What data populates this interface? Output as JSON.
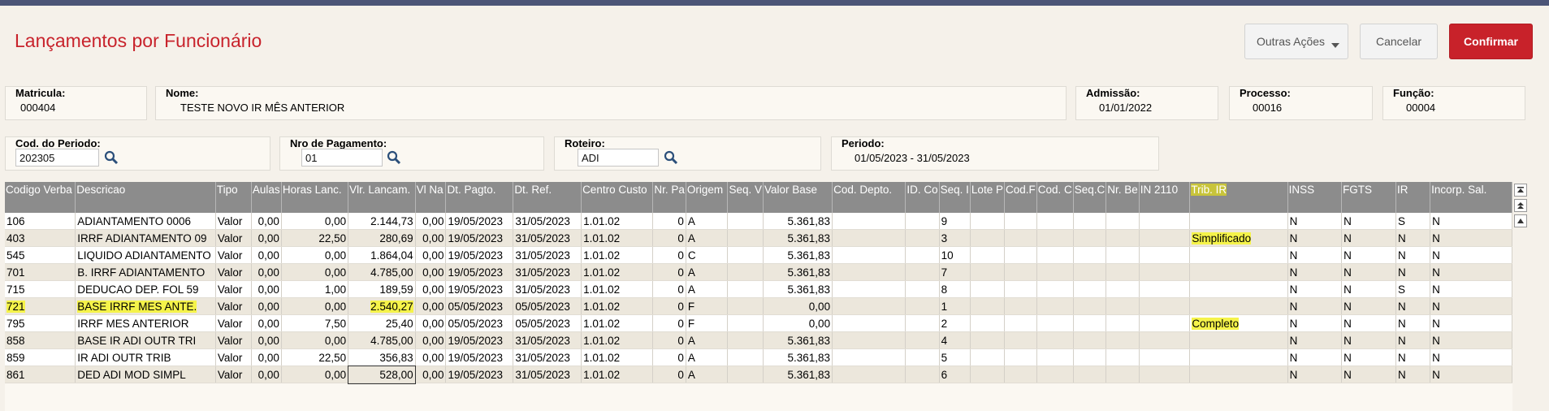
{
  "page": {
    "title": "Lançamentos por Funcionário",
    "buttons": {
      "other_actions": "Outras Ações",
      "cancel": "Cancelar",
      "confirm": "Confirmar"
    }
  },
  "employee": {
    "matricula_label": "Matricula:",
    "matricula": "000404",
    "nome_label": "Nome:",
    "nome": "TESTE NOVO IR MÊS ANTERIOR",
    "admissao_label": "Admissão:",
    "admissao": "01/01/2022",
    "processo_label": "Processo:",
    "processo": "00016",
    "funcao_label": "Função:",
    "funcao": "00004"
  },
  "filters": {
    "periodo_cod_label": "Cod. do Periodo:",
    "periodo_cod": "202305",
    "nro_pag_label": "Nro de Pagamento:",
    "nro_pag": "01",
    "roteiro_label": "Roteiro:",
    "roteiro": "ADI",
    "periodo_label": "Periodo:",
    "periodo": "01/05/2023 - 31/05/2023"
  },
  "grid": {
    "headers": [
      "Codigo Verba",
      "Descricao",
      "Tipo",
      "Aulas",
      "Horas Lanc.",
      "Vlr. Lancam.",
      "Vl Na",
      "Dt. Pagto.",
      "Dt. Ref.",
      "Centro Custo",
      "Nr. Pa",
      "Origem",
      "Seq. V",
      "Valor Base",
      "Cod. Depto.",
      "ID. Co",
      "Seq. I",
      "Lote P",
      "Cod.F",
      "Cod. C",
      "Seq.C",
      "Nr. Be",
      "IN 2110",
      "Trib. IR",
      "INSS",
      "FGTS",
      "IR",
      "Incorp. Sal."
    ],
    "rows": [
      [
        "106",
        "ADIANTAMENTO 0006",
        "Valor",
        "0,00",
        "0,00",
        "2.144,73",
        "0,00",
        "19/05/2023",
        "31/05/2023",
        "1.01.02",
        "0",
        "A",
        "",
        "5.361,83",
        "",
        "",
        "9",
        "",
        "",
        "",
        "",
        "",
        "",
        "",
        "N",
        "N",
        "S",
        "N"
      ],
      [
        "403",
        "IRRF ADIANTAMENTO 09",
        "Valor",
        "0,00",
        "22,50",
        "280,69",
        "0,00",
        "19/05/2023",
        "31/05/2023",
        "1.01.02",
        "0",
        "A",
        "",
        "5.361,83",
        "",
        "",
        "3",
        "",
        "",
        "",
        "",
        "",
        "",
        "Simplificado",
        "N",
        "N",
        "N",
        "N"
      ],
      [
        "545",
        "LIQUIDO ADIANTAMENTO",
        "Valor",
        "0,00",
        "0,00",
        "1.864,04",
        "0,00",
        "19/05/2023",
        "31/05/2023",
        "1.01.02",
        "0",
        "C",
        "",
        "5.361,83",
        "",
        "",
        "10",
        "",
        "",
        "",
        "",
        "",
        "",
        "",
        "N",
        "N",
        "N",
        "N"
      ],
      [
        "701",
        "B. IRRF ADIANTAMENTO",
        "Valor",
        "0,00",
        "0,00",
        "4.785,00",
        "0,00",
        "19/05/2023",
        "31/05/2023",
        "1.01.02",
        "0",
        "A",
        "",
        "5.361,83",
        "",
        "",
        "7",
        "",
        "",
        "",
        "",
        "",
        "",
        "",
        "N",
        "N",
        "N",
        "N"
      ],
      [
        "715",
        "DEDUCAO DEP. FOL 59",
        "Valor",
        "0,00",
        "1,00",
        "189,59",
        "0,00",
        "19/05/2023",
        "31/05/2023",
        "1.01.02",
        "0",
        "A",
        "",
        "5.361,83",
        "",
        "",
        "8",
        "",
        "",
        "",
        "",
        "",
        "",
        "",
        "N",
        "N",
        "S",
        "N"
      ],
      [
        "721",
        "BASE IRRF MES ANTE.",
        "Valor",
        "0,00",
        "0,00",
        "2.540,27",
        "0,00",
        "05/05/2023",
        "05/05/2023",
        "1.01.02",
        "0",
        "F",
        "",
        "0,00",
        "",
        "",
        "1",
        "",
        "",
        "",
        "",
        "",
        "",
        "",
        "N",
        "N",
        "N",
        "N"
      ],
      [
        "795",
        "IRRF MES ANTERIOR",
        "Valor",
        "0,00",
        "7,50",
        "25,40",
        "0,00",
        "05/05/2023",
        "05/05/2023",
        "1.01.02",
        "0",
        "F",
        "",
        "0,00",
        "",
        "",
        "2",
        "",
        "",
        "",
        "",
        "",
        "",
        "Completo",
        "N",
        "N",
        "N",
        "N"
      ],
      [
        "858",
        "BASE IR ADI OUTR TRI",
        "Valor",
        "0,00",
        "0,00",
        "4.785,00",
        "0,00",
        "19/05/2023",
        "31/05/2023",
        "1.01.02",
        "0",
        "A",
        "",
        "5.361,83",
        "",
        "",
        "4",
        "",
        "",
        "",
        "",
        "",
        "",
        "",
        "N",
        "N",
        "N",
        "N"
      ],
      [
        "859",
        "IR ADI OUTR TRIB",
        "Valor",
        "0,00",
        "22,50",
        "356,83",
        "0,00",
        "19/05/2023",
        "31/05/2023",
        "1.01.02",
        "0",
        "A",
        "",
        "5.361,83",
        "",
        "",
        "5",
        "",
        "",
        "",
        "",
        "",
        "",
        "",
        "N",
        "N",
        "N",
        "N"
      ],
      [
        "861",
        "DED ADI MOD SIMPL",
        "Valor",
        "0,00",
        "0,00",
        "528,00",
        "0,00",
        "19/05/2023",
        "31/05/2023",
        "1.01.02",
        "0",
        "A",
        "",
        "5.361,83",
        "",
        "",
        "6",
        "",
        "",
        "",
        "",
        "",
        "",
        "",
        "N",
        "N",
        "N",
        "N"
      ]
    ]
  },
  "colors": {
    "accent": "#c8232c",
    "header_bg": "#8c8c8c",
    "highlight": "#f5f34a"
  }
}
